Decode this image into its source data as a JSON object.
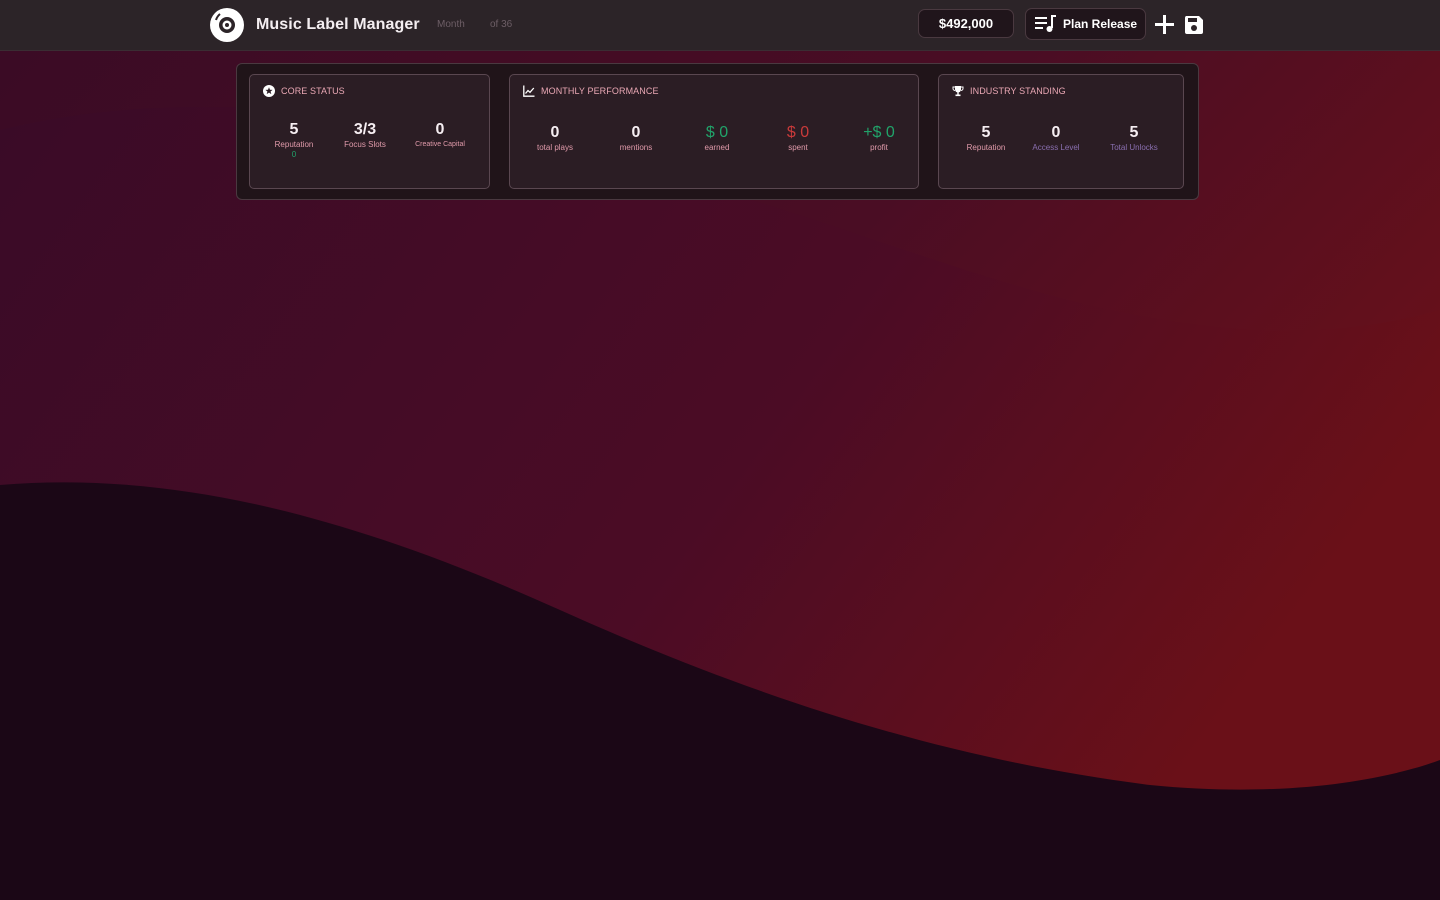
{
  "header": {
    "app_title": "Music Label Manager",
    "month_label": "Month",
    "month_total": "of 36",
    "money": "$492,000",
    "plan_release_label": "Plan Release",
    "add_icon": "plus-icon",
    "save_icon": "save-icon",
    "logo_icon": "vinyl-record-icon"
  },
  "core_status": {
    "title": "CORE STATUS",
    "icon": "star-circle-icon",
    "reputation_value": "5",
    "reputation_label": "Reputation",
    "reputation_change": "0",
    "focus_slots_value": "3/3",
    "focus_slots_label": "Focus Slots",
    "creative_capital_value": "0",
    "creative_capital_label": "Creative Capital"
  },
  "monthly_performance": {
    "title": "MONTHLY PERFORMANCE",
    "icon": "line-chart-icon",
    "plays_value": "0",
    "plays_label": "total plays",
    "mentions_value": "0",
    "mentions_label": "mentions",
    "earned_value": "$ 0",
    "earned_label": "earned",
    "spent_value": "$ 0",
    "spent_label": "spent",
    "profit_value": "+$ 0",
    "profit_label": "profit"
  },
  "industry_standing": {
    "title": "INDUSTRY STANDING",
    "icon": "trophy-icon",
    "reputation_value": "5",
    "reputation_label": "Reputation",
    "access_level_value": "0",
    "access_level_label": "Access Level",
    "total_unlocks_value": "5",
    "total_unlocks_label": "Total Unlocks"
  },
  "colors": {
    "accent_pink": "#e09aaa",
    "positive": "#21a36a",
    "negative": "#c93a3a",
    "muted_violet": "#8a6fb0"
  }
}
